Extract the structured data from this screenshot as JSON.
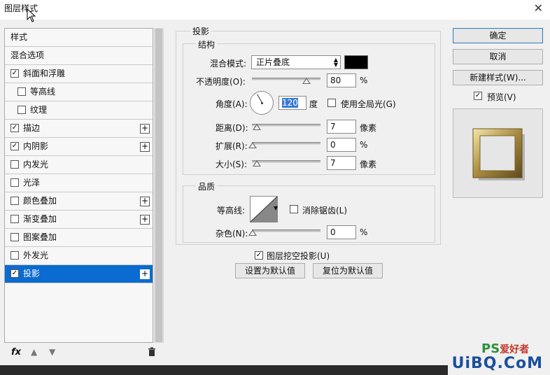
{
  "window": {
    "title": "图层样式"
  },
  "style_list": [
    {
      "label": "样式",
      "checkbox": false,
      "checked": false,
      "plus": false,
      "sub": false,
      "selected": false
    },
    {
      "label": "混合选项",
      "checkbox": false,
      "checked": false,
      "plus": false,
      "sub": false,
      "selected": false
    },
    {
      "label": "斜面和浮雕",
      "checkbox": true,
      "checked": true,
      "plus": false,
      "sub": false,
      "selected": false
    },
    {
      "label": "等高线",
      "checkbox": true,
      "checked": false,
      "plus": false,
      "sub": true,
      "selected": false
    },
    {
      "label": "纹理",
      "checkbox": true,
      "checked": false,
      "plus": false,
      "sub": true,
      "selected": false
    },
    {
      "label": "描边",
      "checkbox": true,
      "checked": true,
      "plus": true,
      "sub": false,
      "selected": false
    },
    {
      "label": "内阴影",
      "checkbox": true,
      "checked": true,
      "plus": true,
      "sub": false,
      "selected": false
    },
    {
      "label": "内发光",
      "checkbox": true,
      "checked": false,
      "plus": false,
      "sub": false,
      "selected": false
    },
    {
      "label": "光泽",
      "checkbox": true,
      "checked": false,
      "plus": false,
      "sub": false,
      "selected": false
    },
    {
      "label": "颜色叠加",
      "checkbox": true,
      "checked": false,
      "plus": true,
      "sub": false,
      "selected": false
    },
    {
      "label": "渐变叠加",
      "checkbox": true,
      "checked": false,
      "plus": true,
      "sub": false,
      "selected": false
    },
    {
      "label": "图案叠加",
      "checkbox": true,
      "checked": false,
      "plus": false,
      "sub": false,
      "selected": false
    },
    {
      "label": "外发光",
      "checkbox": true,
      "checked": false,
      "plus": false,
      "sub": false,
      "selected": false
    },
    {
      "label": "投影",
      "checkbox": true,
      "checked": true,
      "plus": true,
      "sub": false,
      "selected": true
    }
  ],
  "bottom_bar": {
    "fx_label": "fx"
  },
  "shadow": {
    "title": "投影",
    "structure": {
      "title": "结构",
      "blend_mode_label": "混合模式:",
      "blend_mode_value": "正片叠底",
      "shadow_color": "#000000",
      "opacity_label": "不透明度(O):",
      "opacity_value": "80",
      "opacity_unit": "%",
      "angle_label": "角度(A):",
      "angle_value": "120",
      "angle_unit": "度",
      "global_light_label": "使用全局光(G)",
      "global_light_checked": false,
      "distance_label": "距离(D):",
      "distance_value": "7",
      "distance_unit": "像素",
      "spread_label": "扩展(R):",
      "spread_value": "0",
      "spread_unit": "%",
      "size_label": "大小(S):",
      "size_value": "7",
      "size_unit": "像素"
    },
    "quality": {
      "title": "品质",
      "contour_label": "等高线:",
      "anti_alias_label": "消除锯齿(L)",
      "anti_alias_checked": false,
      "noise_label": "杂色(N):",
      "noise_value": "0",
      "noise_unit": "%"
    },
    "knockout_label": "图层挖空投影(U)",
    "knockout_checked": true,
    "make_default_label": "设置为默认值",
    "reset_default_label": "复位为默认值"
  },
  "right_panel": {
    "ok_label": "确定",
    "cancel_label": "取消",
    "new_style_label": "新建样式(W)...",
    "preview_label": "预览(V)",
    "preview_checked": true
  },
  "watermark": {
    "brand": "UiBQ.CoM",
    "ps_text": "PS",
    "site_cn": "爱好者"
  }
}
